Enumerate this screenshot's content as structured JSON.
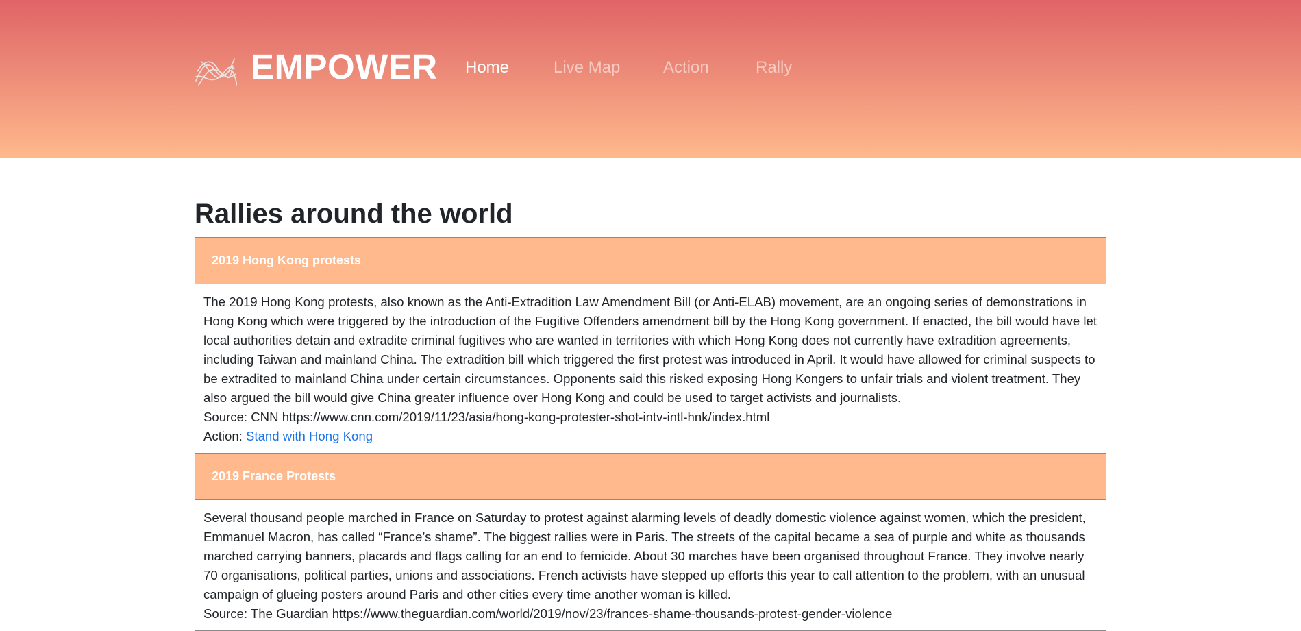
{
  "header": {
    "brand": "EMPOWER",
    "logo_icon": "tangled-lines-logo-icon",
    "nav": [
      {
        "label": "Home",
        "active": true
      },
      {
        "label": "Live Map",
        "active": false
      },
      {
        "label": "Action",
        "active": false
      },
      {
        "label": "Rally",
        "active": false
      }
    ],
    "colors": {
      "gradient_top": "#e06467",
      "gradient_bottom": "#ffb98c"
    }
  },
  "main": {
    "title": "Rallies around the world",
    "rallies": [
      {
        "title": "2019 Hong Kong protests",
        "description": "The 2019 Hong Kong protests, also known as the Anti-Extradition Law Amendment Bill (or Anti-ELAB) movement, are an ongoing series of demonstrations in Hong Kong which were triggered by the introduction of the Fugitive Offenders amendment bill by the Hong Kong government. If enacted, the bill would have let local authorities detain and extradite criminal fugitives who are wanted in territories with which Hong Kong does not currently have extradition agreements, including Taiwan and mainland China. The extradition bill which triggered the first protest was introduced in April. It would have allowed for criminal suspects to be extradited to mainland China under certain circumstances. Opponents said this risked exposing Hong Kongers to unfair trials and violent treatment. They also argued the bill would give China greater influence over Hong Kong and could be used to target activists and journalists.",
        "source": "Source: CNN https://www.cnn.com/2019/11/23/asia/hong-kong-protester-shot-intv-intl-hnk/index.html",
        "action_prefix": "Action:",
        "action_link": "Stand with Hong Kong"
      },
      {
        "title": "2019 France Protests",
        "description": "Several thousand people marched in France on Saturday to protest against alarming levels of deadly domestic violence against women, which the president, Emmanuel Macron, has called “France’s shame”. The biggest rallies were in Paris. The streets of the capital became a sea of purple and white as thousands marched carrying banners, placards and flags calling for an end to femicide. About 30 marches have been organised throughout France. They involve nearly 70 organisations, political parties, unions and associations. French activists have stepped up efforts this year to call attention to the problem, with an unusual campaign of glueing posters around Paris and other cities every time another woman is killed.",
        "source": "Source: The Guardian https://www.theguardian.com/world/2019/nov/23/frances-shame-thousands-protest-gender-violence"
      }
    ],
    "colors": {
      "rally_header_bg": "#ffb98c",
      "link": "#1a73e8"
    }
  }
}
